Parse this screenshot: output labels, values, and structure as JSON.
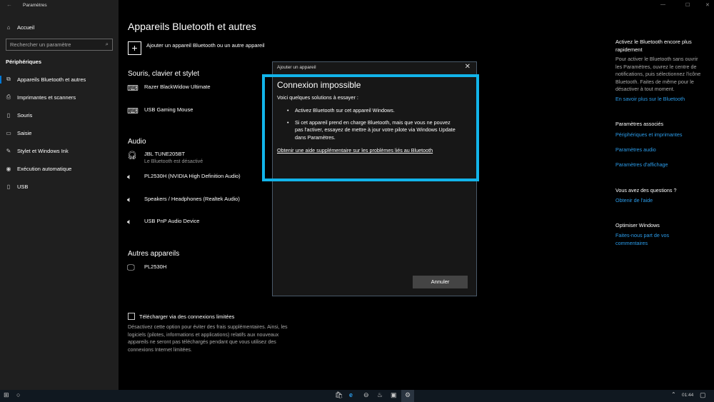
{
  "window": {
    "title": "Paramètres",
    "back": "←",
    "minimize": "—",
    "maximize": "☐",
    "close": "✕"
  },
  "sidebar": {
    "home": "Accueil",
    "search_placeholder": "Rechercher un paramètre",
    "section": "Périphériques",
    "items": [
      {
        "label": "Appareils Bluetooth et autres",
        "icon": "⧉"
      },
      {
        "label": "Imprimantes et scanners",
        "icon": "⎙"
      },
      {
        "label": "Souris",
        "icon": "▯"
      },
      {
        "label": "Saisie",
        "icon": "▭"
      },
      {
        "label": "Stylet et Windows Ink",
        "icon": "✎"
      },
      {
        "label": "Exécution automatique",
        "icon": "◉"
      },
      {
        "label": "USB",
        "icon": "▯"
      }
    ]
  },
  "main": {
    "title": "Appareils Bluetooth et autres",
    "add_device": "Ajouter un appareil Bluetooth ou un autre appareil",
    "sections": {
      "input": "Souris, clavier et stylet",
      "audio": "Audio",
      "other": "Autres appareils"
    },
    "input_devices": [
      "Razer BlackWidow Ultimate",
      "USB Gaming Mouse"
    ],
    "audio_devices": [
      {
        "name": "JBL TUNE205BT",
        "status": "Le Bluetooth est désactivé"
      },
      {
        "name": "PL2530H (NVIDIA High Definition Audio)"
      },
      {
        "name": "Speakers / Headphones (Realtek Audio)"
      },
      {
        "name": "USB PnP Audio Device"
      }
    ],
    "other_devices": [
      "PL2530H"
    ],
    "metered_label": "Télécharger via des connexions limitées",
    "metered_desc": "Désactivez cette option pour éviter des frais supplémentaires. Ainsi, les logiciels (pilotes, informations et applications) relatifs aux nouveaux appareils ne seront pas téléchargés pendant que vous utilisez des connexions Internet limitées."
  },
  "right": {
    "tip_title": "Activez le Bluetooth encore plus rapidement",
    "tip_text": "Pour activer le Bluetooth sans ouvrir les Paramètres, ouvrez le centre de notifications, puis sélectionnez l'icône Bluetooth. Faites de même pour le désactiver à tout moment.",
    "tip_link": "En savoir plus sur le Bluetooth",
    "related_title": "Paramètres associés",
    "related_links": [
      "Périphériques et imprimantes",
      "Paramètres audio",
      "Paramètres d'affichage"
    ],
    "questions_title": "Vous avez des questions ?",
    "questions_link": "Obtenir de l'aide",
    "improve_title": "Optimiser Windows",
    "improve_link": "Faites-nous part de vos commentaires"
  },
  "dialog": {
    "title": "Ajouter un appareil",
    "heading": "Connexion impossible",
    "intro": "Voici quelques solutions à essayer :",
    "bullets": [
      "Activez Bluetooth sur cet appareil Windows.",
      "Si cet appareil prend en charge Bluetooth, mais que vous ne pouvez pas l'activer, essayez de mettre à jour votre pilote via Windows Update dans Paramètres."
    ],
    "help_link": "Obtenir une aide supplémentaire sur les problèmes liés au Bluetooth",
    "cancel": "Annuler"
  },
  "taskbar": {
    "time": "01:44"
  },
  "colors": {
    "highlight": "#12b4ea",
    "accent": "#0078d7",
    "link": "#2b9cea"
  }
}
